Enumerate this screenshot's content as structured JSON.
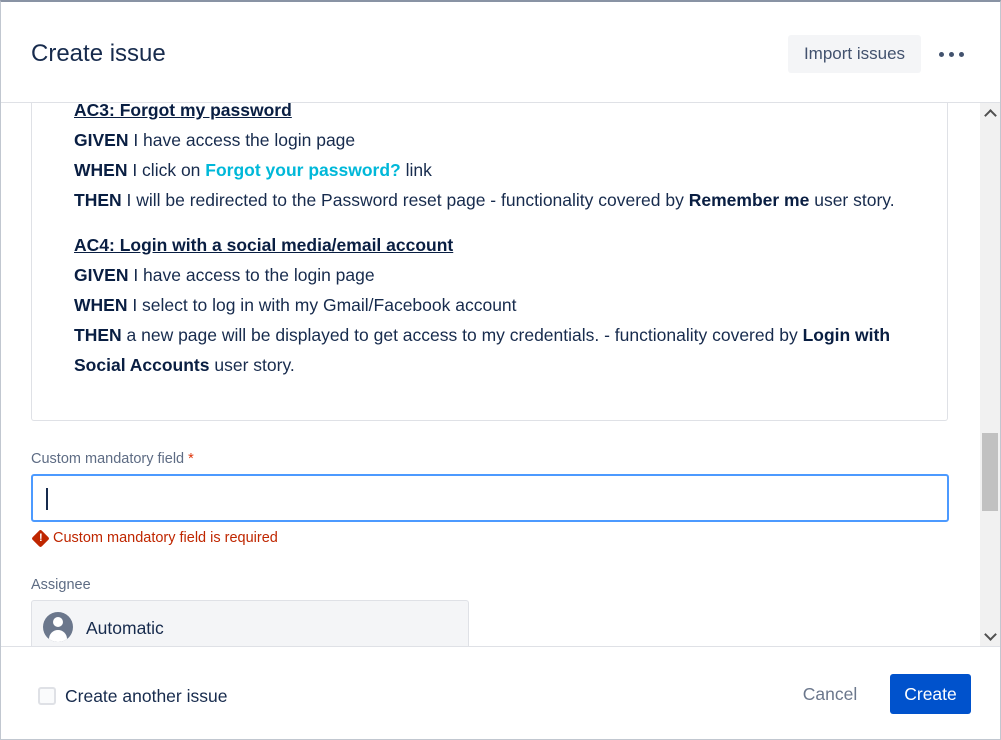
{
  "header": {
    "title": "Create issue",
    "import_label": "Import issues",
    "more_icon": "more-horizontal-icon"
  },
  "description": {
    "ac3": {
      "heading": "AC3: Forgot my password",
      "given_kw": "GIVEN",
      "given_text": " I have access the login page",
      "when_kw": "WHEN",
      "when_text": " I click on ",
      "when_link": "Forgot your password?",
      "when_tail": " link",
      "then_kw": "THEN",
      "then_text": " I will be redirected to the Password reset page - functionality covered by ",
      "then_bold": "Remember me",
      "then_tail": " user story."
    },
    "ac4": {
      "heading": "AC4: Login with a social media/email account",
      "given_kw": "GIVEN",
      "given_text": " I have access to the login page",
      "when_kw": "WHEN",
      "when_text": " I select to log in with my Gmail/Facebook account",
      "then_kw": "THEN",
      "then_text": " a new page will be displayed to get access to my credentials. - functionality covered by ",
      "then_bold1": "Login with",
      "then_bold2": "Social Accounts",
      "then_tail": " user story."
    }
  },
  "custom_field": {
    "label": "Custom mandatory field",
    "required_mark": "*",
    "value": "",
    "error": "Custom mandatory field is required"
  },
  "assignee": {
    "label": "Assignee",
    "value": "Automatic"
  },
  "footer": {
    "create_another_label": "Create another issue",
    "create_another_checked": false,
    "cancel_label": "Cancel",
    "create_label": "Create"
  },
  "colors": {
    "primary": "#0052cc",
    "link": "#00b8d9",
    "error": "#bf2600",
    "focus_border": "#4c9aff"
  }
}
